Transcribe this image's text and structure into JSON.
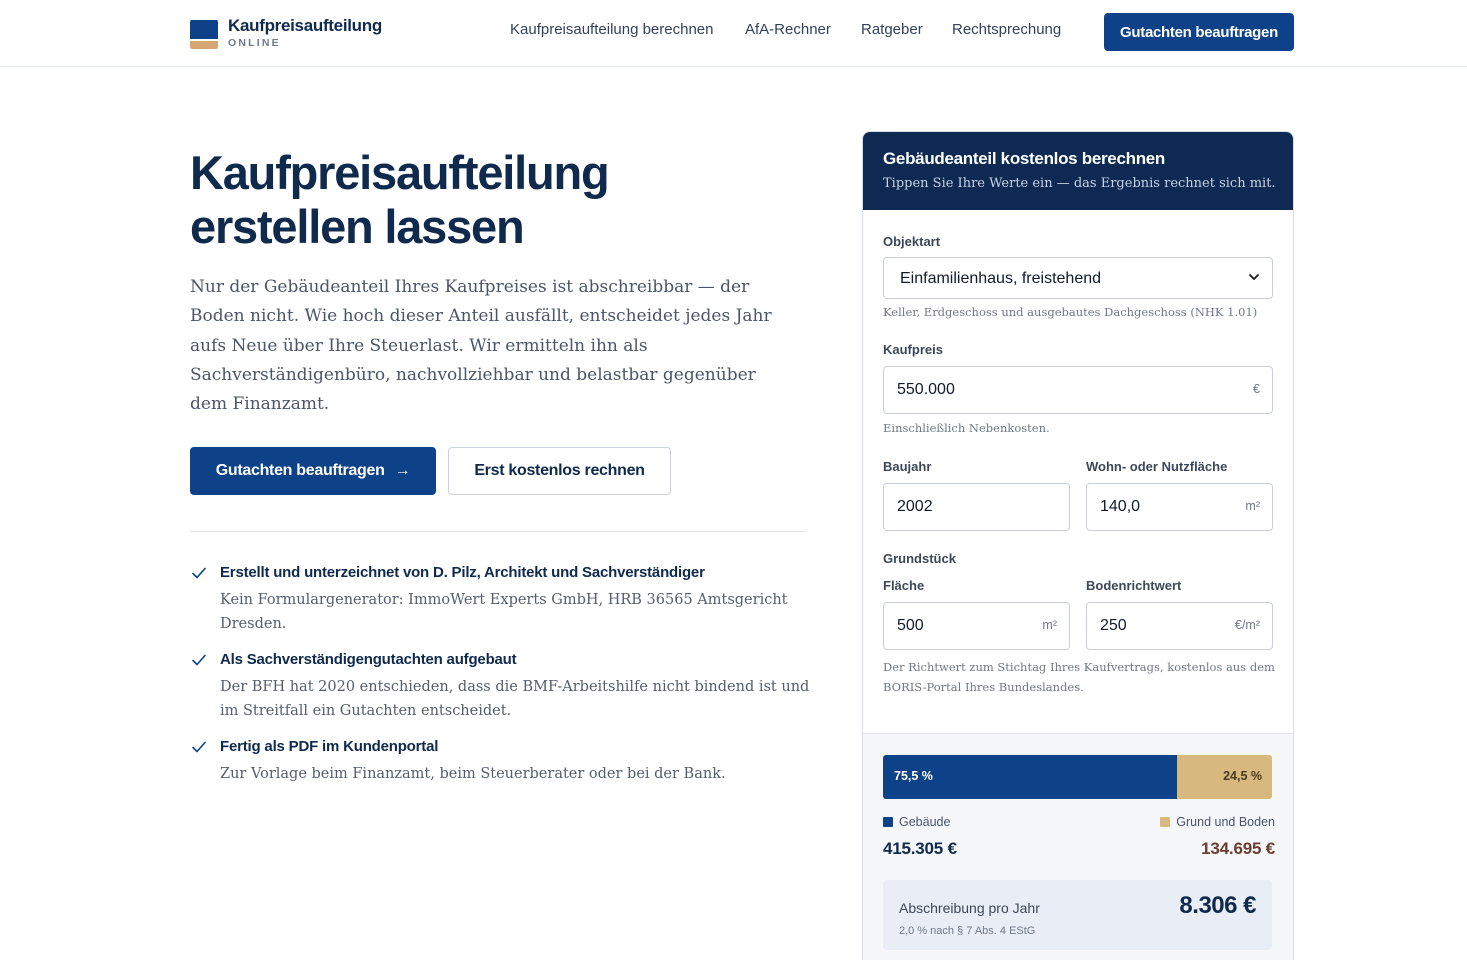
{
  "brand": {
    "name": "Kaufpreisaufteilung",
    "tagline": "ONLINE"
  },
  "nav": {
    "items": [
      "Kaufpreisaufteilung berechnen",
      "AfA-Rechner",
      "Ratgeber",
      "Rechtsprechung"
    ],
    "cta_label": "Gutachten beauftragen"
  },
  "hero": {
    "title_line1": "Kaufpreisaufteilung",
    "title_line2": "erstellen lassen",
    "text": "Nur der Gebäudeanteil Ihres Kaufpreises ist abschreibbar — der Boden nicht. Wie hoch dieser Anteil ausfällt, entscheidet jedes Jahr aufs Neue über Ihre Steuerlast. Wir ermitteln ihn als Sachverständigenbüro, nachvollziehbar und belastbar gegenüber dem Finanzamt.",
    "primary_label": "Gutachten beauftragen",
    "primary_arrow": "→",
    "secondary_label": "Erst kostenlos rechnen"
  },
  "features": [
    {
      "title": "Erstellt und unterzeichnet von D. Pilz, Architekt und Sachverständiger",
      "text": "Kein Formulargenerator: ImmoWert Experts GmbH, HRB 36565 Amtsgericht Dresden."
    },
    {
      "title": "Als Sachverständigengutachten aufgebaut",
      "text": "Der BFH hat 2020 entschieden, dass die BMF-Arbeitshilfe nicht bindend ist und im Streitfall ein Gutachten entscheidet."
    },
    {
      "title": "Fertig als PDF im Kundenportal",
      "text": "Zur Vorlage beim Finanzamt, beim Steuerberater oder bei der Bank."
    }
  ],
  "calculator": {
    "title": "Gebäudeanteil kostenlos berechnen",
    "subtitle": "Tippen Sie Ihre Werte ein — das Ergebnis rechnet sich mit.",
    "objektart": {
      "label": "Objektart",
      "value": "Einfamilienhaus, freistehend",
      "hint": "Keller, Erdgeschoss und ausgebautes Dachgeschoss (NHK 1.01)"
    },
    "kaufpreis": {
      "label": "Kaufpreis",
      "value": "550.000",
      "unit": "€",
      "hint": "Einschließlich Nebenkosten."
    },
    "baujahr": {
      "label": "Baujahr",
      "value": "2002"
    },
    "flaeche_wohn": {
      "label": "Wohn- oder Nutzfläche",
      "value": "140,0",
      "unit": "m²"
    },
    "grundstueck_label": "Grundstück",
    "flaeche": {
      "label": "Fläche",
      "value": "500",
      "unit": "m²"
    },
    "bodenrichtwert": {
      "label": "Bodenrichtwert",
      "value": "250",
      "unit": "€/m²"
    },
    "richtwert_hint": "Der Richtwert zum Stichtag Ihres Kaufvertrags, kostenlos aus dem BORIS-Portal Ihres Bundeslandes."
  },
  "result": {
    "building_share": 75.5,
    "building_pct_label": "75,5 %",
    "land_pct_label": "24,5 %",
    "building_label": "Gebäude",
    "land_label": "Grund und Boden",
    "building_amount": "415.305 €",
    "land_amount": "134.695 €",
    "afa_label": "Abschreibung pro Jahr",
    "afa_note": "2,0 % nach § 7 Abs. 4 EStG",
    "afa_value": "8.306 €"
  },
  "colors": {
    "primary": "#0e4288",
    "dark": "#0e2a52",
    "accent": "#d7b97f",
    "land_text": "#6b3d2e"
  }
}
